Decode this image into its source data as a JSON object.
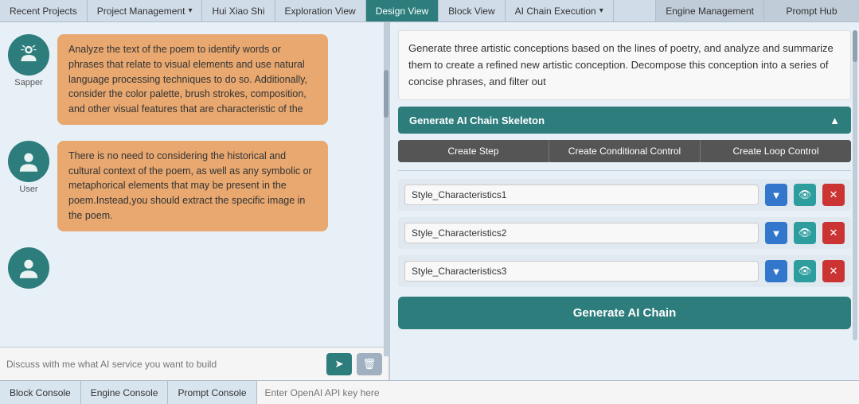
{
  "nav": {
    "tabs_left": [
      {
        "id": "recent-projects",
        "label": "Recent Projects",
        "active": false,
        "dropdown": false
      },
      {
        "id": "project-management",
        "label": "Project Management",
        "active": false,
        "dropdown": true
      },
      {
        "id": "hui-xiao-shi",
        "label": "Hui Xiao Shi",
        "active": false,
        "dropdown": false
      },
      {
        "id": "exploration-view",
        "label": "Exploration View",
        "active": false,
        "dropdown": false
      },
      {
        "id": "design-view",
        "label": "Design View",
        "active": true,
        "dropdown": false
      },
      {
        "id": "block-view",
        "label": "Block View",
        "active": false,
        "dropdown": false
      },
      {
        "id": "ai-chain-execution",
        "label": "AI Chain Execution",
        "active": false,
        "dropdown": true
      }
    ],
    "tabs_right": [
      {
        "id": "engine-management",
        "label": "Engine Management"
      },
      {
        "id": "prompt-hub",
        "label": "Prompt Hub"
      }
    ]
  },
  "chat": {
    "messages": [
      {
        "id": "sapper",
        "avatar_label": "Sapper",
        "text": "Analyze the text of the poem to identify words or phrases that relate to visual elements and use natural language processing techniques to do so. Additionally, consider the color palette, brush strokes, composition, and other visual features that are characteristic of the"
      },
      {
        "id": "user",
        "avatar_label": "User",
        "text": "There is no need to considering the historical and cultural context of the poem, as well as any symbolic or metaphorical elements that may be present in the poem.Instead,you should extract the specific image in the poem."
      }
    ],
    "input_placeholder": "Discuss with me what AI service you want to build"
  },
  "right_panel": {
    "prompt_text": "Generate three artistic conceptions based on the lines of poetry, and analyze and summarize them to create a refined new artistic conception. Decompose this conception into a series of concise phrases, and filter out",
    "generate_skeleton_label": "Generate AI Chain Skeleton",
    "chevron_icon": "▲",
    "control_buttons": [
      {
        "id": "create-step",
        "label": "Create Step"
      },
      {
        "id": "create-conditional",
        "label": "Create Conditional Control"
      },
      {
        "id": "create-loop",
        "label": "Create Loop Control"
      }
    ],
    "steps": [
      {
        "id": "step1",
        "value": "Style_Characteristics1"
      },
      {
        "id": "step2",
        "value": "Style_Characteristics2"
      },
      {
        "id": "step3",
        "value": "Style_Characteristics3"
      }
    ],
    "generate_chain_label": "Generate AI Chain"
  },
  "bottom": {
    "tabs": [
      {
        "id": "block-console",
        "label": "Block Console"
      },
      {
        "id": "engine-console",
        "label": "Engine Console"
      },
      {
        "id": "prompt-console",
        "label": "Prompt Console"
      }
    ],
    "api_key_placeholder": "Enter OpenAI API key here"
  },
  "icons": {
    "send": "➤",
    "clear": "🗑",
    "chevron_down": "▼",
    "eye": "👁",
    "close": "✕",
    "chevron_up": "▲"
  }
}
